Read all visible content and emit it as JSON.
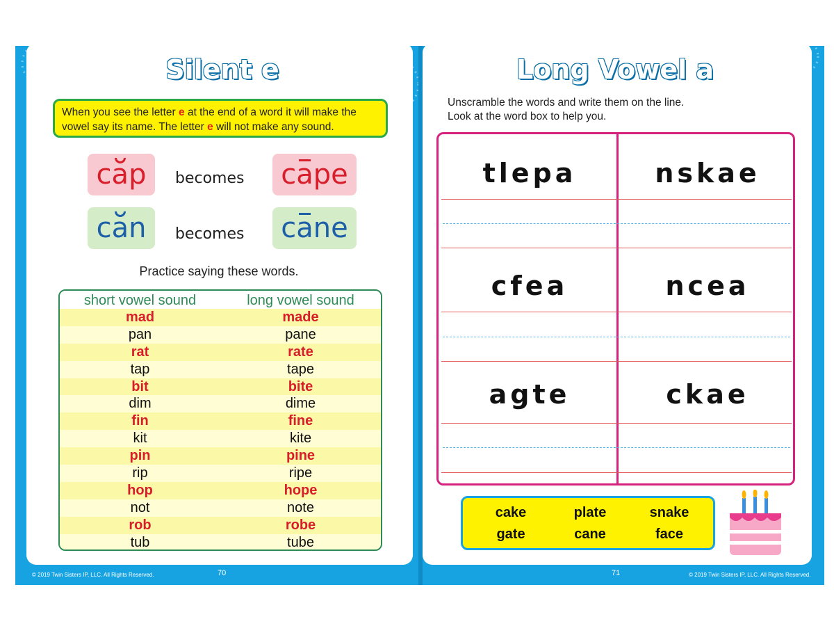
{
  "left_page": {
    "title": "Silent e",
    "rule_parts": [
      "When you see the letter ",
      "e",
      " at the end of a word it will make the vowel say its name. The letter ",
      "e",
      " will not make any sound."
    ],
    "examples": [
      {
        "short_word": "cap",
        "becomes": "becomes",
        "long_word": "cape"
      },
      {
        "short_word": "can",
        "becomes": "becomes",
        "long_word": "cane"
      }
    ],
    "practice_text": "Practice saying these words.",
    "table": {
      "headers": [
        "short vowel sound",
        "long vowel sound"
      ],
      "rows": [
        [
          "mad",
          "made"
        ],
        [
          "pan",
          "pane"
        ],
        [
          "rat",
          "rate"
        ],
        [
          "tap",
          "tape"
        ],
        [
          "bit",
          "bite"
        ],
        [
          "dim",
          "dime"
        ],
        [
          "fin",
          "fine"
        ],
        [
          "kit",
          "kite"
        ],
        [
          "pin",
          "pine"
        ],
        [
          "rip",
          "ripe"
        ],
        [
          "hop",
          "hope"
        ],
        [
          "not",
          "note"
        ],
        [
          "rob",
          "robe"
        ],
        [
          "tub",
          "tube"
        ]
      ]
    },
    "copyright": "© 2019 Twin Sisters IP, LLC. All Rights Reserved.",
    "page_number": "70"
  },
  "right_page": {
    "title": "Long Vowel a",
    "instructions_line1": "Unscramble the words and write them on the line.",
    "instructions_line2": "Look at the word box to help you.",
    "scrambled": [
      "tlepa",
      "nskae",
      "cfea",
      "ncea",
      "agte",
      "ckae"
    ],
    "word_box": [
      "cake",
      "plate",
      "snake",
      "gate",
      "cane",
      "face"
    ],
    "copyright": "© 2019 Twin Sisters IP, LLC. All Rights Reserved.",
    "page_number": "71"
  },
  "colors": {
    "background_blue": "#17a3e2",
    "rule_box_yellow": "#fff200",
    "red_text": "#d81e2a",
    "grid_magenta": "#d6217f",
    "table_green": "#2e8b57"
  }
}
